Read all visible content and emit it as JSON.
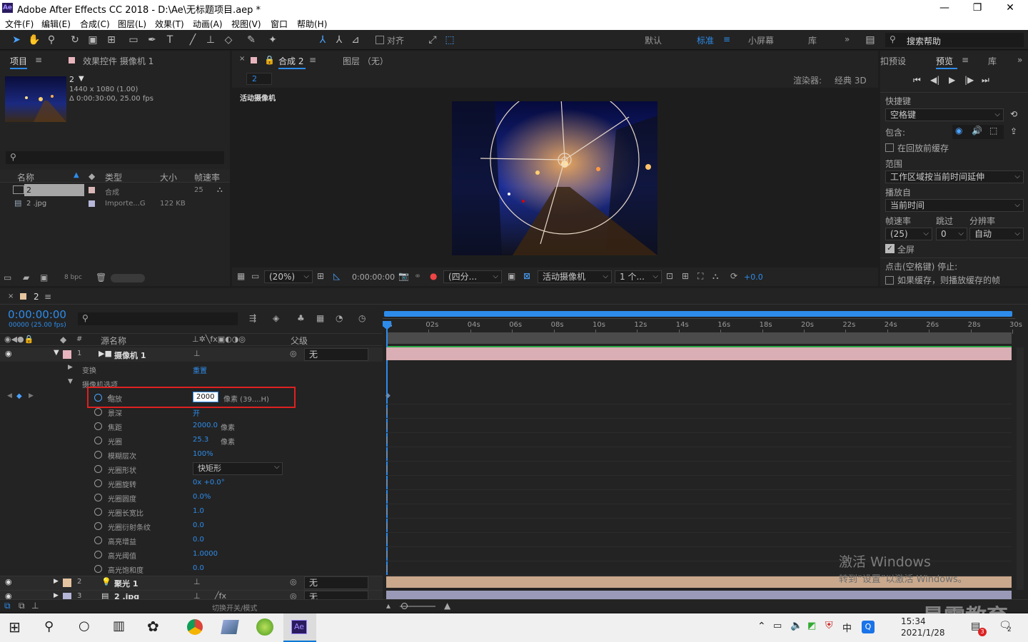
{
  "window": {
    "title": "Adobe After Effects CC 2018 - D:\\Ae\\无标题项目.aep *",
    "logo": "Ae",
    "minimize": "—",
    "restore": "❐",
    "close": "✕"
  },
  "menu": [
    "文件(F)",
    "编辑(E)",
    "合成(C)",
    "图层(L)",
    "效果(T)",
    "动画(A)",
    "视图(V)",
    "窗口",
    "帮助(H)"
  ],
  "toolbar": {
    "snap_label": "对齐",
    "workspaces": [
      "默认",
      "标准",
      "小屏幕",
      "库"
    ],
    "active_workspace": "标准",
    "search_placeholder": "搜索帮助"
  },
  "project_panel": {
    "tab": "项目",
    "effects_tab": "效果控件 摄像机 1",
    "selected_name": "2",
    "selected_info1": "1440 x 1080 (1.00)",
    "selected_info2": "Δ 0:00:30:00, 25.00 fps",
    "columns": {
      "name": "名称",
      "type": "类型",
      "size": "大小",
      "fps": "帧速率"
    },
    "items": [
      {
        "name": "2",
        "type": "合成",
        "size": "",
        "fps": "25",
        "color": "#d9b7b7"
      },
      {
        "name": "2 .jpg",
        "type": "Importe...G",
        "size": "122 KB",
        "fps": "",
        "color": "#b6b6d8"
      }
    ],
    "bpc": "8 bpc"
  },
  "comp_panel": {
    "tab": "合成 2",
    "layer_tab": "图层 （无）",
    "breadcrumb": "2",
    "renderer_label": "渲染器:",
    "renderer_value": "经典 3D",
    "view_label": "活动摄像机",
    "zoom": "(20%)",
    "time": "0:00:00:00",
    "resolution": "(四分...",
    "camera_view": "活动摄像机",
    "views": "1 个...",
    "exposure": "+0.0"
  },
  "preview_panel": {
    "tab_prev": "扣预设",
    "tab": "预览",
    "tab_lib": "库",
    "shortcut_label": "快捷键",
    "shortcut_value": "空格键",
    "include_label": "包含:",
    "cache_label": "在回放前缓存",
    "range_label": "范围",
    "range_value": "工作区域按当前时间延伸",
    "play_from_label": "播放自",
    "play_from_value": "当前时间",
    "fps_label": "帧速率",
    "skip_label": "跳过",
    "res_label": "分辨率",
    "fps_value": "(25)",
    "skip_value": "0",
    "res_value": "自动",
    "fullscreen_label": "全屏",
    "stop_label": "点击(空格键) 停止:",
    "if_cache_label": "如果缓存，则播放缓存的帧"
  },
  "timeline": {
    "tab": "2",
    "timecode": "0:00:00:00",
    "timecode_sub": "00000 (25.00 fps)",
    "col_source": "源名称",
    "col_parent": "父级",
    "col_num": "#",
    "ruler": [
      "0s",
      "02s",
      "04s",
      "06s",
      "08s",
      "10s",
      "12s",
      "14s",
      "16s",
      "18s",
      "20s",
      "22s",
      "24s",
      "26s",
      "28s",
      "30s"
    ],
    "layers": [
      {
        "num": "1",
        "name": "摄像机 1",
        "parent": "无",
        "color": "#e8b4bd"
      },
      {
        "num": "2",
        "name": "聚光 1",
        "parent": "无",
        "color": "#e5c4a0"
      },
      {
        "num": "3",
        "name": "2 .jpg",
        "parent": "无",
        "color": "#b6b6d8"
      }
    ],
    "transform_label": "变换",
    "transform_value": "重置",
    "camera_options_label": "摄像机选项",
    "properties": [
      {
        "name": "缩放",
        "value": "2000",
        "unit": "像素 (39....H)"
      },
      {
        "name": "景深",
        "value": "开",
        "unit": ""
      },
      {
        "name": "焦距",
        "value": "2000.0",
        "unit": "像素"
      },
      {
        "name": "光圈",
        "value": "25.3",
        "unit": "像素"
      },
      {
        "name": "模糊层次",
        "value": "100%",
        "unit": ""
      },
      {
        "name": "光圈形状",
        "value": "快矩形",
        "unit": ""
      },
      {
        "name": "光圈旋转",
        "value": "0x +0.0°",
        "unit": ""
      },
      {
        "name": "光圈圆度",
        "value": "0.0%",
        "unit": ""
      },
      {
        "name": "光圈长宽比",
        "value": "1.0",
        "unit": ""
      },
      {
        "name": "光圈衍射条纹",
        "value": "0.0",
        "unit": ""
      },
      {
        "name": "高亮增益",
        "value": "0.0",
        "unit": ""
      },
      {
        "name": "高光阈值",
        "value": "1.0000",
        "unit": ""
      },
      {
        "name": "高光饱和度",
        "value": "0.0",
        "unit": ""
      }
    ],
    "footer_toggle": "切换开关/模式"
  },
  "watermark": {
    "line1": "激活 Windows",
    "line2": "转到“设置”以激活 Windows。",
    "brand": "最需教育"
  },
  "taskbar": {
    "time": "15:34",
    "date": "2021/1/28",
    "ime": "中",
    "notif_count": "2",
    "badge_count": "3"
  },
  "colors": {
    "accent": "#2d8ceb",
    "highlight_box": "#e02020",
    "camera_bar": "#d9aeb4",
    "light_bar": "#c9a88c",
    "image_bar": "#9a9ab8",
    "workarea": "#2d8ceb"
  }
}
